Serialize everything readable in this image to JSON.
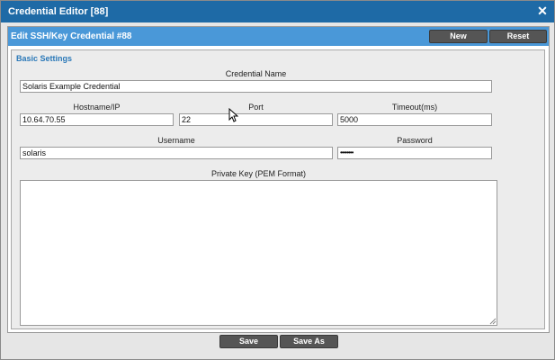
{
  "window": {
    "title": "Credential Editor [88]",
    "close_glyph": "✕"
  },
  "panel": {
    "title": "Edit SSH/Key Credential #88",
    "new_label": "New",
    "reset_label": "Reset"
  },
  "basic_settings": {
    "legend": "Basic Settings",
    "credential_name": {
      "label": "Credential Name",
      "value": "Solaris Example Credential"
    },
    "hostname": {
      "label": "Hostname/IP",
      "value": "10.64.70.55"
    },
    "port": {
      "label": "Port",
      "value": "22"
    },
    "timeout": {
      "label": "Timeout(ms)",
      "value": "5000"
    },
    "username": {
      "label": "Username",
      "value": "solaris"
    },
    "password": {
      "label": "Password",
      "value": "••••••••"
    },
    "private_key": {
      "label": "Private Key (PEM Format)",
      "value": ""
    }
  },
  "footer": {
    "save_label": "Save",
    "save_as_label": "Save As"
  },
  "colors": {
    "titlebar": "#1e6aa6",
    "panel_header": "#4a98d8",
    "legend": "#2a78b8",
    "button": "#555555"
  }
}
